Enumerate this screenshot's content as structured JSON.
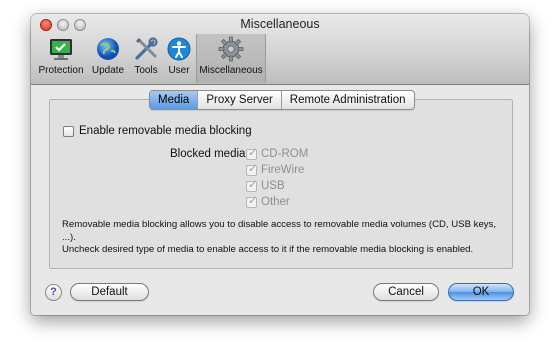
{
  "window": {
    "title": "Miscellaneous"
  },
  "toolbar": {
    "items": [
      {
        "label": "Protection",
        "icon": "protection-monitor-icon"
      },
      {
        "label": "Update",
        "icon": "globe-icon"
      },
      {
        "label": "Tools",
        "icon": "tools-icon"
      },
      {
        "label": "User",
        "icon": "user-icon"
      },
      {
        "label": "Miscellaneous",
        "icon": "gear-icon",
        "selected": true
      }
    ]
  },
  "tabs": [
    {
      "label": "Media",
      "active": true
    },
    {
      "label": "Proxy Server",
      "active": false
    },
    {
      "label": "Remote Administration",
      "active": false
    }
  ],
  "media": {
    "enable_label": "Enable removable media blocking",
    "enable_checked": false,
    "blocked_label": "Blocked media:",
    "items": [
      {
        "label": "CD-ROM",
        "checked": true,
        "enabled": false
      },
      {
        "label": "FireWire",
        "checked": true,
        "enabled": false
      },
      {
        "label": "USB",
        "checked": true,
        "enabled": false
      },
      {
        "label": "Other",
        "checked": true,
        "enabled": false
      }
    ],
    "description_line1": "Removable media blocking allows you to disable access to removable media volumes (CD, USB keys, ...).",
    "description_line2": "Uncheck desired type of media to enable access to it if the removable media blocking is enabled."
  },
  "buttons": {
    "help": "?",
    "default": "Default",
    "cancel": "Cancel",
    "ok": "OK"
  },
  "colors": {
    "selected_tab": "#5c9ae0",
    "ok_button": "#4e91e0",
    "close_button": "#d8321f",
    "help_glyph": "#6a3ea8"
  }
}
